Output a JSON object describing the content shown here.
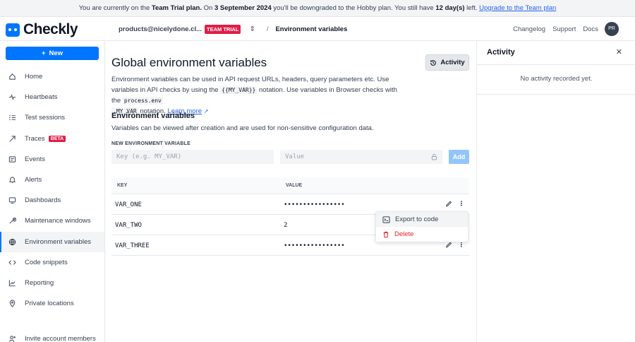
{
  "banner": {
    "t1": "You are currently on the ",
    "plan": "Team Trial plan.",
    "t2": " On ",
    "date": "3 September 2024",
    "t3": " you'll be downgraded to the Hobby plan. You still have ",
    "days": "12 day(s)",
    "t4": " left. ",
    "link": "Upgrade to the Team plan"
  },
  "brand": {
    "name": "Checkly",
    "accent": "#0075ff"
  },
  "topbar": {
    "account": "products@nicelydone.cl...",
    "trial_badge": "TEAM TRIAL",
    "separator": "/",
    "page": "Environment variables",
    "links": [
      "Changelog",
      "Support",
      "Docs"
    ],
    "avatar": "PR"
  },
  "sidebar": {
    "new_label": "New",
    "items": [
      {
        "label": "Home",
        "icon": "home-icon"
      },
      {
        "label": "Heartbeats",
        "icon": "heartbeat-icon"
      },
      {
        "label": "Test sessions",
        "icon": "list-icon"
      },
      {
        "label": "Traces",
        "icon": "traces-icon",
        "badge": "BETA"
      },
      {
        "label": "Events",
        "icon": "events-icon"
      },
      {
        "label": "Alerts",
        "icon": "bell-icon"
      },
      {
        "label": "Dashboards",
        "icon": "monitor-icon"
      },
      {
        "label": "Maintenance windows",
        "icon": "wrench-icon"
      },
      {
        "label": "Environment variables",
        "icon": "globe-icon",
        "active": true
      },
      {
        "label": "Code snippets",
        "icon": "code-icon"
      },
      {
        "label": "Reporting",
        "icon": "chart-icon"
      },
      {
        "label": "Private locations",
        "icon": "pin-icon"
      }
    ],
    "invite": "Invite account members"
  },
  "main": {
    "title": "Global environment variables",
    "activity_button": "Activity",
    "desc": {
      "p1": "Environment variables can be used in API request URLs, headers, query parameters etc. Use variables in API checks by using the ",
      "code1": "{{MY_VAR}}",
      "p2": " notation. Use variables in Browser checks with the ",
      "code2": "process.env",
      "code3": ".MY_VAR",
      "p3": " notation. ",
      "link": "Learn more"
    },
    "section_title": "Environment variables",
    "section_desc": "Variables can be viewed after creation and are used for non-sensitive configuration data.",
    "new_label": "NEW ENVIRONMENT VARIABLE",
    "key_placeholder": "Key (e.g. MY_VAR)",
    "value_placeholder": "Value",
    "add_button": "Add",
    "table": {
      "headers": {
        "key": "KEY",
        "value": "VALUE"
      },
      "rows": [
        {
          "key": "VAR_ONE",
          "value": "••••••••••••••••"
        },
        {
          "key": "VAR_TWO",
          "value": "2"
        },
        {
          "key": "VAR_THREE",
          "value": "••••••••••••••••"
        }
      ]
    },
    "menu": {
      "export": "Export to code",
      "delete": "Delete"
    }
  },
  "panel": {
    "title": "Activity",
    "close": "✕",
    "empty": "No activity recorded yet."
  }
}
